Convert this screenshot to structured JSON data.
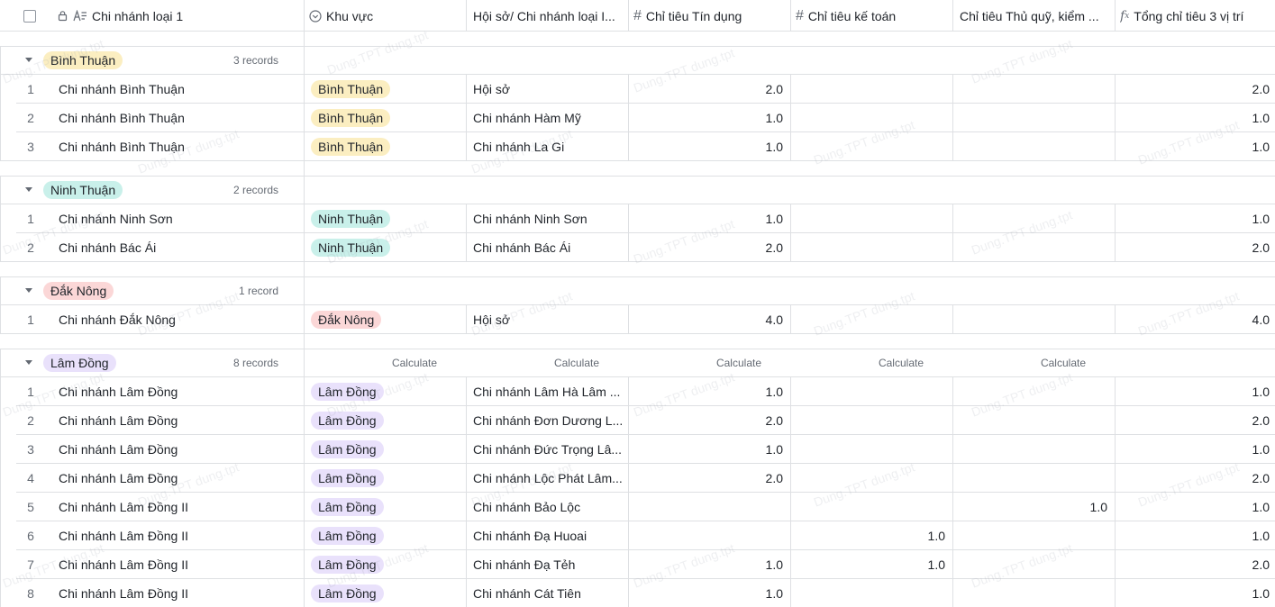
{
  "header": {
    "col_name": "Chi nhánh loại 1",
    "col_region": "Khu vực",
    "col_hq": "Hội sở/ Chi nhánh loại I...",
    "col_credit": "Chỉ tiêu Tín dụng",
    "col_accounting": "Chỉ tiêu kế toán",
    "col_cashier": "Chỉ tiêu Thủ quỹ, kiểm ...",
    "col_total": "Tổng chỉ tiêu 3 vị trí"
  },
  "colors": {
    "binh_thuan": "#fbeec1",
    "ninh_thuan": "#c9f0ea",
    "dak_nong": "#fbd7d7",
    "lam_dong": "#e9e1fb",
    "border": "#dee0e3"
  },
  "watermark": "Dung.TPT dung.tpt",
  "calculate_label": "Calculate",
  "groups": [
    {
      "name": "Bình Thuận",
      "count": "3 records",
      "color_key": "binh_thuan",
      "rows": [
        {
          "idx": "1",
          "name": "Chi nhánh Bình Thuận",
          "region": "Bình Thuận",
          "hq": "Hội sở",
          "credit": "2.0",
          "accounting": "",
          "cashier": "",
          "total": "2.0"
        },
        {
          "idx": "2",
          "name": "Chi nhánh Bình Thuận",
          "region": "Bình Thuận",
          "hq": "Chi nhánh Hàm Mỹ",
          "credit": "1.0",
          "accounting": "",
          "cashier": "",
          "total": "1.0"
        },
        {
          "idx": "3",
          "name": "Chi nhánh Bình Thuận",
          "region": "Bình Thuận",
          "hq": "Chi nhánh La Gi",
          "credit": "1.0",
          "accounting": "",
          "cashier": "",
          "total": "1.0"
        }
      ]
    },
    {
      "name": "Ninh Thuận",
      "count": "2 records",
      "color_key": "ninh_thuan",
      "rows": [
        {
          "idx": "1",
          "name": "Chi nhánh Ninh Sơn",
          "region": "Ninh Thuận",
          "hq": "Chi nhánh Ninh Sơn",
          "credit": "1.0",
          "accounting": "",
          "cashier": "",
          "total": "1.0"
        },
        {
          "idx": "2",
          "name": "Chi nhánh Bác Ái",
          "region": "Ninh Thuận",
          "hq": "Chi nhánh Bác Ái",
          "credit": "2.0",
          "accounting": "",
          "cashier": "",
          "total": "2.0"
        }
      ]
    },
    {
      "name": "Đắk Nông",
      "count": "1 record",
      "color_key": "dak_nong",
      "rows": [
        {
          "idx": "1",
          "name": "Chi nhánh Đắk Nông",
          "region": "Đắk Nông",
          "hq": "Hội sở",
          "credit": "4.0",
          "accounting": "",
          "cashier": "",
          "total": "4.0"
        }
      ]
    },
    {
      "name": "Lâm Đồng",
      "count": "8 records",
      "color_key": "lam_dong",
      "show_calculate": true,
      "rows": [
        {
          "idx": "1",
          "name": "Chi nhánh Lâm Đồng",
          "region": "Lâm Đồng",
          "hq": "Chi nhánh Lâm Hà Lâm ...",
          "credit": "1.0",
          "accounting": "",
          "cashier": "",
          "total": "1.0"
        },
        {
          "idx": "2",
          "name": "Chi nhánh Lâm Đồng",
          "region": "Lâm Đồng",
          "hq": "Chi nhánh Đơn Dương L...",
          "credit": "2.0",
          "accounting": "",
          "cashier": "",
          "total": "2.0"
        },
        {
          "idx": "3",
          "name": "Chi nhánh Lâm Đồng",
          "region": "Lâm Đồng",
          "hq": "Chi nhánh Đức Trọng Lâ...",
          "credit": "1.0",
          "accounting": "",
          "cashier": "",
          "total": "1.0"
        },
        {
          "idx": "4",
          "name": "Chi nhánh Lâm Đồng",
          "region": "Lâm Đồng",
          "hq": "Chi nhánh Lộc Phát Lâm...",
          "credit": "2.0",
          "accounting": "",
          "cashier": "",
          "total": "2.0"
        },
        {
          "idx": "5",
          "name": "Chi nhánh Lâm Đồng II",
          "region": "Lâm Đồng",
          "hq": "Chi nhánh Bảo Lộc",
          "credit": "",
          "accounting": "",
          "cashier": "1.0",
          "total": "1.0"
        },
        {
          "idx": "6",
          "name": "Chi nhánh Lâm Đồng II",
          "region": "Lâm Đồng",
          "hq": "Chi nhánh Đạ Huoai",
          "credit": "",
          "accounting": "1.0",
          "cashier": "",
          "total": "1.0"
        },
        {
          "idx": "7",
          "name": "Chi nhánh Lâm Đồng II",
          "region": "Lâm Đồng",
          "hq": "Chi nhánh Đạ Tẻh",
          "credit": "1.0",
          "accounting": "1.0",
          "cashier": "",
          "total": "2.0"
        },
        {
          "idx": "8",
          "name": "Chi nhánh Lâm Đồng II",
          "region": "Lâm Đồng",
          "hq": "Chi nhánh Cát Tiên",
          "credit": "1.0",
          "accounting": "",
          "cashier": "",
          "total": "1.0"
        }
      ]
    }
  ]
}
